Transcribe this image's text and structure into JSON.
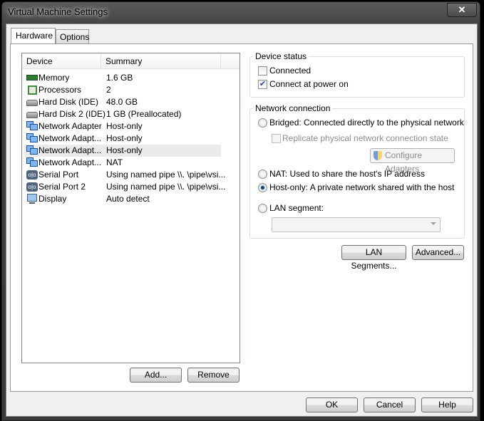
{
  "window": {
    "title": "Virtual Machine Settings",
    "close_label": "✕"
  },
  "tabs": [
    {
      "label": "Hardware"
    },
    {
      "label": "Options"
    }
  ],
  "device_list": {
    "headers": {
      "device": "Device",
      "summary": "Summary"
    },
    "rows": [
      {
        "icon": "memory-icon",
        "device": "Memory",
        "summary": "1.6 GB"
      },
      {
        "icon": "processor-icon",
        "device": "Processors",
        "summary": "2"
      },
      {
        "icon": "hard-disk-icon",
        "device": "Hard Disk (IDE)",
        "summary": "48.0 GB"
      },
      {
        "icon": "hard-disk-icon",
        "device": "Hard Disk 2 (IDE)",
        "summary": "1 GB (Preallocated)"
      },
      {
        "icon": "network-adapter-icon",
        "device": "Network Adapter",
        "summary": "Host-only"
      },
      {
        "icon": "network-adapter-icon",
        "device": "Network Adapt...",
        "summary": "Host-only"
      },
      {
        "icon": "network-adapter-icon",
        "device": "Network Adapt...",
        "summary": "Host-only",
        "selected": true
      },
      {
        "icon": "network-adapter-icon",
        "device": "Network Adapt...",
        "summary": "NAT"
      },
      {
        "icon": "serial-port-icon",
        "device": "Serial Port",
        "summary": "Using named pipe \\\\. \\pipe\\vsi..."
      },
      {
        "icon": "serial-port-icon",
        "device": "Serial Port 2",
        "summary": "Using named pipe \\\\. \\pipe\\vsi..."
      },
      {
        "icon": "display-icon",
        "device": "Display",
        "summary": "Auto detect"
      }
    ],
    "add_label": "Add...",
    "remove_label": "Remove"
  },
  "device_status": {
    "title": "Device status",
    "connected": {
      "label": "Connected",
      "checked": false
    },
    "connect_at_power_on": {
      "label": "Connect at power on",
      "checked": true
    }
  },
  "network_connection": {
    "title": "Network connection",
    "bridged": "Bridged: Connected directly to the physical network",
    "replicate": "Replicate physical network connection state",
    "configure_adapters": "Configure Adapters",
    "nat": "NAT: Used to share the host's IP address",
    "host_only": "Host-only: A private network shared with the host",
    "lan_segment": "LAN segment:",
    "selected": "host_only",
    "lan_segment_value": ""
  },
  "lan_segments_label": "LAN Segments...",
  "advanced_label": "Advanced...",
  "footer": {
    "ok": "OK",
    "cancel": "Cancel",
    "help": "Help"
  }
}
